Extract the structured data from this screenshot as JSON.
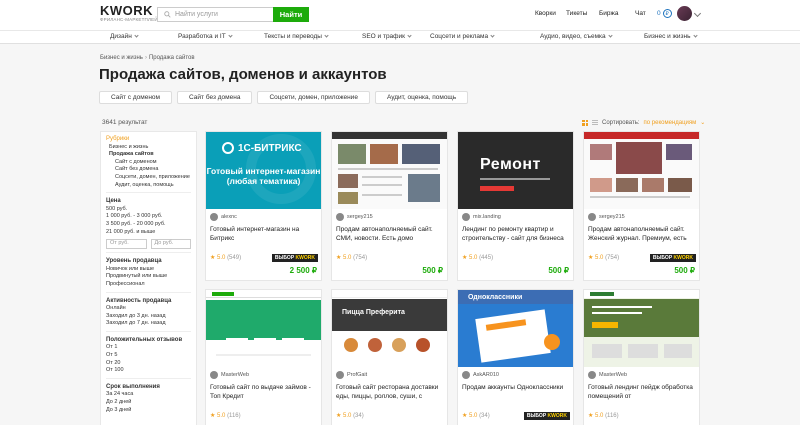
{
  "header": {
    "logo": "KWORK",
    "logo_sub": "ФРИЛАНС-МАРКЕТПЛЕЙС",
    "search_placeholder": "Найти услуги",
    "search_button": "Найти",
    "nav": [
      "Кворки",
      "Тикеты",
      "Биржа",
      "Чат"
    ],
    "coins": "0"
  },
  "categories": [
    "Дизайн",
    "Разработка и IT",
    "Тексты и переводы",
    "SEO и трафик",
    "Соцсети и реклама",
    "Аудио, видео, съемка",
    "Бизнес и жизнь"
  ],
  "breadcrumb": [
    "Бизнес и жизнь",
    "Продажа сайтов"
  ],
  "page_title": "Продажа сайтов, доменов и аккаунтов",
  "chips": [
    "Сайт с доменом",
    "Сайт без домена",
    "Соцсети, домен, приложение",
    "Аудит, оценка, помощь"
  ],
  "results_count": "3641 результат",
  "sort": {
    "label": "Сортировать:",
    "value": "по рекомендациям"
  },
  "sidebar": {
    "rubrics_title": "Рубрики",
    "rubrics": [
      "Бизнес и жизнь",
      "Продажа сайтов",
      "Сайт с доменом",
      "Сайт без домена",
      "Соцсети, домен, приложение",
      "Аудит, оценка, помощь"
    ],
    "price_title": "Цена",
    "prices": [
      "500 руб.",
      "1 000 руб. - 3 000 руб.",
      "3 500 руб. - 20 000 руб.",
      "21 000 руб. и выше"
    ],
    "price_from": "От руб.",
    "price_to": "До руб.",
    "level_title": "Уровень продавца",
    "levels": [
      "Новичок или выше",
      "Продвинутый или выше",
      "Профессионал"
    ],
    "activity_title": "Активность продавца",
    "activity": [
      "Онлайн",
      "Заходил до 3 дн. назад",
      "Заходил до 7 дн. назад"
    ],
    "reviews_title": "Положительных отзывов",
    "reviews": [
      "От 1",
      "От 5",
      "От 20",
      "От 100"
    ],
    "delivery_title": "Срок выполнения",
    "delivery": [
      "За 24 часа",
      "До 2 дней",
      "До 3 дней"
    ]
  },
  "cards": [
    {
      "seller": "alexnc",
      "title": "Готовый интернет-магазин на Битрикс",
      "rating": "5.0",
      "reviews": "(549)",
      "badge": true,
      "price": "2 500 ₽",
      "thumb_logo": "1С-БИТРИКС",
      "thumb_text": "Готовый интернет-магазин (любая тематика)"
    },
    {
      "seller": "sergey215",
      "title": "Продам автонаполняемый сайт. СМИ, новости. Есть домо",
      "rating": "5.0",
      "reviews": "(754)",
      "badge": false,
      "price": "500 ₽"
    },
    {
      "seller": "mix.landing",
      "title": "Лендинг по ремонту квартир и строительству - сайт для бизнеса",
      "rating": "5.0",
      "reviews": "(445)",
      "badge": false,
      "price": "500 ₽",
      "thumb_text": "Ремонт"
    },
    {
      "seller": "sergey215",
      "title": "Продам автонаполняемый сайт. Женский журнал. Премиум, есть",
      "rating": "5.0",
      "reviews": "(754)",
      "badge": true,
      "price": "500 ₽"
    },
    {
      "seller": "MasterWeb",
      "title": "Готовый сайт по выдаче займов - Топ Кредит",
      "rating": "5.0",
      "reviews": "(116)",
      "badge": false,
      "price": ""
    },
    {
      "seller": "ProfGait",
      "title": "Готовый сайт ресторана доставки еды, пиццы, роллов, суши, с",
      "rating": "5.0",
      "reviews": "(34)",
      "badge": false,
      "price": "",
      "thumb_text": "Пицца Преферита"
    },
    {
      "seller": "AskAR010",
      "title": "Продам аккаунты Одноклассники",
      "rating": "5.0",
      "reviews": "(34)",
      "badge": true,
      "price": "",
      "thumb_text": "Одноклассники"
    },
    {
      "seller": "MasterWeb",
      "title": "Готовый лендинг пейдж обработка помещений от",
      "rating": "5.0",
      "reviews": "(116)",
      "badge": false,
      "price": ""
    }
  ],
  "badge_text": {
    "a": "ВЫБОР",
    "b": "KWORK"
  }
}
